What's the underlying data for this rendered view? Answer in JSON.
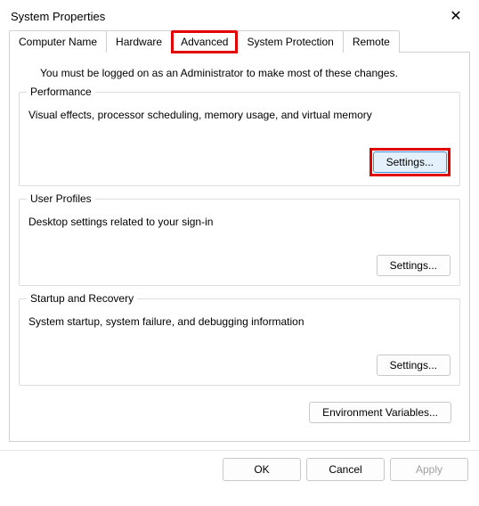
{
  "window": {
    "title": "System Properties",
    "close_glyph": "✕"
  },
  "tabs": {
    "computer_name": "Computer Name",
    "hardware": "Hardware",
    "advanced": "Advanced",
    "system_protection": "System Protection",
    "remote": "Remote"
  },
  "advanced_panel": {
    "admin_note": "You must be logged on as an Administrator to make most of these changes.",
    "performance": {
      "legend": "Performance",
      "desc": "Visual effects, processor scheduling, memory usage, and virtual memory",
      "settings_label": "Settings..."
    },
    "user_profiles": {
      "legend": "User Profiles",
      "desc": "Desktop settings related to your sign-in",
      "settings_label": "Settings..."
    },
    "startup_recovery": {
      "legend": "Startup and Recovery",
      "desc": "System startup, system failure, and debugging information",
      "settings_label": "Settings..."
    },
    "env_vars_label": "Environment Variables..."
  },
  "footer": {
    "ok": "OK",
    "cancel": "Cancel",
    "apply": "Apply"
  }
}
